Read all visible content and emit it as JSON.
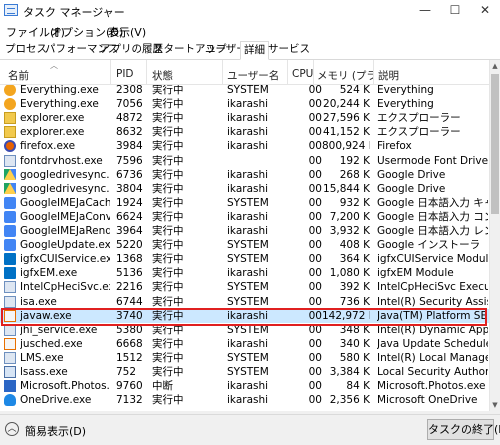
{
  "window": {
    "title": "タスク マネージャー",
    "minimize": "—",
    "maximize": "☐",
    "close": "✕"
  },
  "menu": [
    "ファイル(F)",
    "オプション(O)",
    "表示(V)"
  ],
  "tabs": [
    "プロセス",
    "パフォーマンス",
    "アプリの履歴",
    "スタートアップ",
    "ユーザー",
    "詳細",
    "サービス"
  ],
  "active_tab": "詳細",
  "columns": {
    "name": "名前",
    "pid": "PID",
    "status": "状態",
    "user": "ユーザー名",
    "cpu": "CPU",
    "memory": "メモリ (プライ...",
    "description": "説明"
  },
  "rows": [
    {
      "name": "Everything.exe",
      "pid": "2308",
      "status": "実行中",
      "user": "SYSTEM",
      "cpu": "00",
      "mem": "524 K",
      "desc": "Everything",
      "icon": "everything-icon"
    },
    {
      "name": "Everything.exe",
      "pid": "7056",
      "status": "実行中",
      "user": "ikarashi",
      "cpu": "00",
      "mem": "20,244 K",
      "desc": "Everything",
      "icon": "everything-icon"
    },
    {
      "name": "explorer.exe",
      "pid": "4872",
      "status": "実行中",
      "user": "ikarashi",
      "cpu": "00",
      "mem": "27,596 K",
      "desc": "エクスプローラー",
      "icon": "folder-icon"
    },
    {
      "name": "explorer.exe",
      "pid": "8632",
      "status": "実行中",
      "user": "ikarashi",
      "cpu": "00",
      "mem": "41,152 K",
      "desc": "エクスプローラー",
      "icon": "folder-icon"
    },
    {
      "name": "firefox.exe",
      "pid": "3984",
      "status": "実行中",
      "user": "ikarashi",
      "cpu": "00",
      "mem": "800,924 K",
      "desc": "Firefox",
      "icon": "firefox-icon"
    },
    {
      "name": "fontdrvhost.exe",
      "pid": "7596",
      "status": "実行中",
      "user": "",
      "cpu": "00",
      "mem": "192 K",
      "desc": "Usermode Font Driver H...",
      "icon": "app-window-icon"
    },
    {
      "name": "googledrivesync.exe",
      "pid": "6736",
      "status": "実行中",
      "user": "ikarashi",
      "cpu": "00",
      "mem": "268 K",
      "desc": "Google Drive",
      "icon": "google-drive-icon"
    },
    {
      "name": "googledrivesync.exe",
      "pid": "3804",
      "status": "実行中",
      "user": "ikarashi",
      "cpu": "00",
      "mem": "15,844 K",
      "desc": "Google Drive",
      "icon": "google-drive-icon"
    },
    {
      "name": "GoogleIMEJaCacheS...",
      "pid": "1924",
      "status": "実行中",
      "user": "SYSTEM",
      "cpu": "00",
      "mem": "932 K",
      "desc": "Google 日本語入力 キャ...",
      "icon": "google-ime-icon"
    },
    {
      "name": "GoogleIMEJaConvert...",
      "pid": "6624",
      "status": "実行中",
      "user": "ikarashi",
      "cpu": "00",
      "mem": "7,200 K",
      "desc": "Google 日本語入力 コン...",
      "icon": "google-ime-icon"
    },
    {
      "name": "GoogleIMEJaRender...",
      "pid": "3964",
      "status": "実行中",
      "user": "ikarashi",
      "cpu": "00",
      "mem": "3,932 K",
      "desc": "Google 日本語入力 レン...",
      "icon": "google-ime-icon"
    },
    {
      "name": "GoogleUpdate.exe",
      "pid": "5220",
      "status": "実行中",
      "user": "SYSTEM",
      "cpu": "00",
      "mem": "408 K",
      "desc": "Google インストーラ",
      "icon": "google-update-icon"
    },
    {
      "name": "igfxCUIService.exe",
      "pid": "1368",
      "status": "実行中",
      "user": "SYSTEM",
      "cpu": "00",
      "mem": "364 K",
      "desc": "igfxCUIService Module",
      "icon": "intel-icon"
    },
    {
      "name": "igfxEM.exe",
      "pid": "5136",
      "status": "実行中",
      "user": "ikarashi",
      "cpu": "00",
      "mem": "1,080 K",
      "desc": "igfxEM Module",
      "icon": "intel-icon"
    },
    {
      "name": "IntelCpHeciSvc.exe",
      "pid": "2216",
      "status": "実行中",
      "user": "SYSTEM",
      "cpu": "00",
      "mem": "392 K",
      "desc": "IntelCpHeciSvc Executa...",
      "icon": "app-window-icon"
    },
    {
      "name": "isa.exe",
      "pid": "6744",
      "status": "実行中",
      "user": "SYSTEM",
      "cpu": "00",
      "mem": "736 K",
      "desc": "Intel(R) Security Assist",
      "icon": "app-window-icon"
    },
    {
      "name": "javaw.exe",
      "pid": "3740",
      "status": "実行中",
      "user": "ikarashi",
      "cpu": "00",
      "mem": "142,972 K",
      "desc": "Java(TM) Platform SE bi...",
      "icon": "java-icon"
    },
    {
      "name": "jhi_service.exe",
      "pid": "5380",
      "status": "実行中",
      "user": "SYSTEM",
      "cpu": "00",
      "mem": "348 K",
      "desc": "Intel(R) Dynamic Applic...",
      "icon": "app-window-icon"
    },
    {
      "name": "jusched.exe",
      "pid": "6668",
      "status": "実行中",
      "user": "ikarashi",
      "cpu": "00",
      "mem": "340 K",
      "desc": "Java Update Scheduler",
      "icon": "java-icon"
    },
    {
      "name": "LMS.exe",
      "pid": "1512",
      "status": "実行中",
      "user": "SYSTEM",
      "cpu": "00",
      "mem": "580 K",
      "desc": "Intel(R) Local Managem...",
      "icon": "app-window-icon"
    },
    {
      "name": "lsass.exe",
      "pid": "752",
      "status": "実行中",
      "user": "SYSTEM",
      "cpu": "00",
      "mem": "3,384 K",
      "desc": "Local Security Authority...",
      "icon": "lsass-icon"
    },
    {
      "name": "Microsoft.Photos.exe",
      "pid": "9760",
      "status": "中断",
      "user": "ikarashi",
      "cpu": "00",
      "mem": "84 K",
      "desc": "Microsoft.Photos.exe",
      "icon": "photos-icon"
    },
    {
      "name": "OneDrive.exe",
      "pid": "7132",
      "status": "実行中",
      "user": "ikarashi",
      "cpu": "00",
      "mem": "2,356 K",
      "desc": "Microsoft OneDrive",
      "icon": "onedrive-icon"
    }
  ],
  "footer": {
    "fewer_details": "簡易表示(D)",
    "end_task": "タスクの終了(E)"
  }
}
